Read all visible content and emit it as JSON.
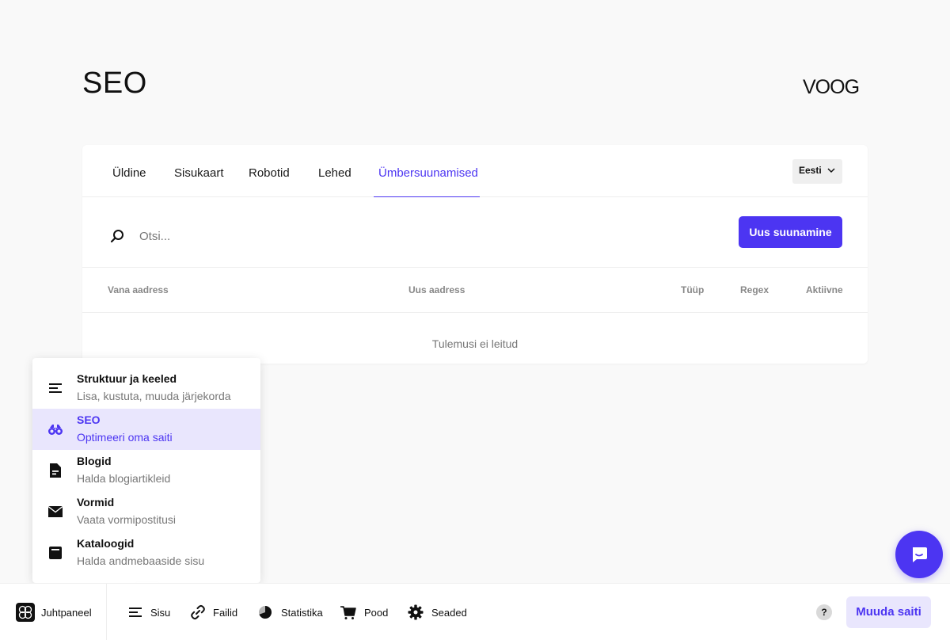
{
  "page": {
    "title": "SEO",
    "brand": "VOOG"
  },
  "tabs": [
    {
      "label": "Üldine"
    },
    {
      "label": "Sisukaart"
    },
    {
      "label": "Robotid"
    },
    {
      "label": "Lehed"
    },
    {
      "label": "Ümbersuunamised",
      "active": true
    }
  ],
  "language": {
    "selected": "Eesti"
  },
  "search": {
    "placeholder": "Otsi..."
  },
  "toolbar": {
    "new_redirect_label": "Uus suunamine"
  },
  "table": {
    "columns": [
      "Vana aadress",
      "Uus aadress",
      "Tüüp",
      "Regex",
      "Aktiivne"
    ],
    "empty_text": "Tulemusi ei leitud"
  },
  "menu": {
    "items": [
      {
        "title": "Struktuur ja keeled",
        "subtitle": "Lisa, kustuta, muuda järjekorda",
        "icon": "structure-icon"
      },
      {
        "title": "SEO",
        "subtitle": "Optimeeri oma saiti",
        "icon": "binoculars-icon",
        "active": true
      },
      {
        "title": "Blogid",
        "subtitle": "Halda blogiartikleid",
        "icon": "document-icon"
      },
      {
        "title": "Vormid",
        "subtitle": "Vaata vormipostitusi",
        "icon": "envelope-icon"
      },
      {
        "title": "Kataloogid",
        "subtitle": "Halda andmebaaside sisu",
        "icon": "catalog-icon"
      }
    ]
  },
  "bottombar": {
    "dashboard_label": "Juhtpaneel",
    "nav": [
      {
        "label": "Sisu",
        "icon": "content-icon"
      },
      {
        "label": "Failid",
        "icon": "link-icon"
      },
      {
        "label": "Statistika",
        "icon": "pie-chart-icon"
      },
      {
        "label": "Pood",
        "icon": "cart-icon"
      },
      {
        "label": "Seaded",
        "icon": "gear-icon"
      }
    ],
    "help_label": "?",
    "edit_site_label": "Muuda saiti"
  },
  "colors": {
    "accent": "#4c35f2",
    "accent_light": "#e9e6fd"
  }
}
